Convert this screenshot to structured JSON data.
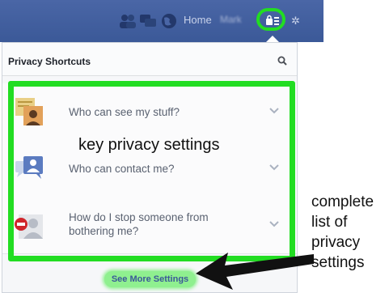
{
  "topbar": {
    "home_label": "Home",
    "user_label": "Mark",
    "icons": [
      "friends-icon",
      "messages-icon",
      "globe-icon",
      "privacy-lock-icon"
    ]
  },
  "panel": {
    "title": "Privacy Shortcuts",
    "search_icon": "search-icon",
    "items": [
      {
        "label": "Who can see my stuff?",
        "icon": "notes-icon"
      },
      {
        "label": "Who can contact me?",
        "icon": "contact-icon"
      },
      {
        "label": "How do I stop someone from bothering me?",
        "icon": "block-icon"
      }
    ],
    "see_more_label": "See More Settings"
  },
  "annotations": {
    "callout": "key privacy settings",
    "note": "complete list of privacy settings"
  },
  "colors": {
    "topbar": "#3b5998",
    "highlight": "#22dd22"
  }
}
